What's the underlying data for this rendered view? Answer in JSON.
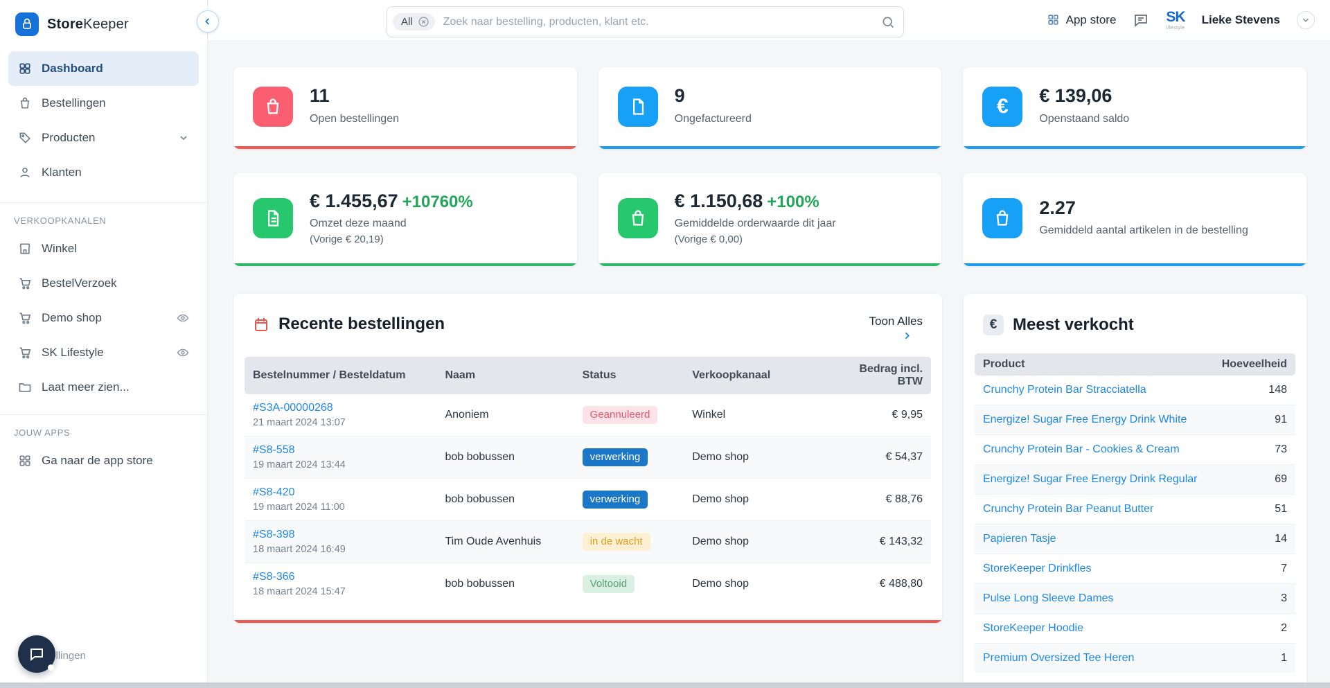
{
  "brand": {
    "name_bold": "Store",
    "name_light": "Keeper"
  },
  "topbar": {
    "search_filter": "All",
    "search_placeholder": "Zoek naar bestelling, producten, klant etc.",
    "app_store": "App store",
    "logo_text": "SK",
    "logo_sub": "lifestyle",
    "user_name": "Lieke Stevens"
  },
  "sidebar": {
    "nav": [
      {
        "label": "Dashboard"
      },
      {
        "label": "Bestellingen"
      },
      {
        "label": "Producten"
      },
      {
        "label": "Klanten"
      }
    ],
    "sections": {
      "sales": "VERKOOPKANALEN",
      "apps": "JOUW APPS"
    },
    "sales_channels": [
      {
        "label": "Winkel"
      },
      {
        "label": "BestelVerzoek"
      },
      {
        "label": "Demo shop"
      },
      {
        "label": "SK Lifestyle"
      },
      {
        "label": "Laat meer zien..."
      }
    ],
    "apps": [
      {
        "label": "Ga naar de app store"
      }
    ],
    "bottom_partial": "tellingen"
  },
  "stats": [
    {
      "value": "11",
      "label": "Open bestellingen",
      "accent": "#f2564d"
    },
    {
      "value": "9",
      "label": "Ongefactureerd",
      "accent": "#1d9bf1"
    },
    {
      "value": "€ 139,06",
      "label": "Openstaand saldo",
      "accent": "#1d9bf1"
    },
    {
      "value": "€ 1.455,67",
      "delta": "+10760%",
      "label": "Omzet deze maand",
      "sub": "(Vorige € 20,19)",
      "accent": "#2db96a"
    },
    {
      "value": "€ 1.150,68",
      "delta": "+100%",
      "label": "Gemiddelde orderwaarde dit jaar",
      "sub": "(Vorige € 0,00)",
      "accent": "#2db96a"
    },
    {
      "value": "2.27",
      "label": "Gemiddeld aantal artikelen in de bestelling",
      "accent": "#1d9bf1"
    }
  ],
  "orders": {
    "title": "Recente bestellingen",
    "show_all": "Toon Alles",
    "headers": [
      "Bestelnummer / Besteldatum",
      "Naam",
      "Status",
      "Verkoopkanaal",
      "Bedrag incl. BTW"
    ],
    "rows": [
      {
        "number": "#S3A-00000268",
        "date": "21 maart 2024 13:07",
        "name": "Anoniem",
        "status": "Geannuleerd",
        "channel": "Winkel",
        "amount": "€ 9,95"
      },
      {
        "number": "#S8-558",
        "date": "19 maart 2024 13:44",
        "name": "bob bobussen",
        "status": "verwerking",
        "channel": "Demo shop",
        "amount": "€ 54,37"
      },
      {
        "number": "#S8-420",
        "date": "19 maart 2024 11:00",
        "name": "bob bobussen",
        "status": "verwerking",
        "channel": "Demo shop",
        "amount": "€ 88,76"
      },
      {
        "number": "#S8-398",
        "date": "18 maart 2024 16:49",
        "name": "Tim Oude Avenhuis",
        "status": "in de wacht",
        "channel": "Demo shop",
        "amount": "€ 143,32"
      },
      {
        "number": "#S8-366",
        "date": "18 maart 2024 15:47",
        "name": "bob bobussen",
        "status": "Voltooid",
        "channel": "Demo shop",
        "amount": "€ 488,80"
      }
    ],
    "status_colors": {
      "geannuleerd": "#e9556d",
      "verwerking": "#1b78c8",
      "in_de_wacht": "#df9c27",
      "voltooid": "#57a273"
    }
  },
  "bestsellers": {
    "title": "Meest verkocht",
    "headers": [
      "Product",
      "Hoeveelheid"
    ],
    "rows": [
      {
        "product": "Crunchy Protein Bar Stracciatella",
        "qty": "148"
      },
      {
        "product": "Energize! Sugar Free Energy Drink White",
        "qty": "91"
      },
      {
        "product": "Crunchy Protein Bar - Cookies & Cream",
        "qty": "73"
      },
      {
        "product": "Energize! Sugar Free Energy Drink Regular",
        "qty": "69"
      },
      {
        "product": "Crunchy Protein Bar Peanut Butter",
        "qty": "51"
      },
      {
        "product": "Papieren Tasje",
        "qty": "14"
      },
      {
        "product": "StoreKeeper Drinkfles",
        "qty": "7"
      },
      {
        "product": "Pulse Long Sleeve Dames",
        "qty": "3"
      },
      {
        "product": "StoreKeeper Hoodie",
        "qty": "2"
      },
      {
        "product": "Premium Oversized Tee Heren",
        "qty": "1"
      }
    ]
  }
}
